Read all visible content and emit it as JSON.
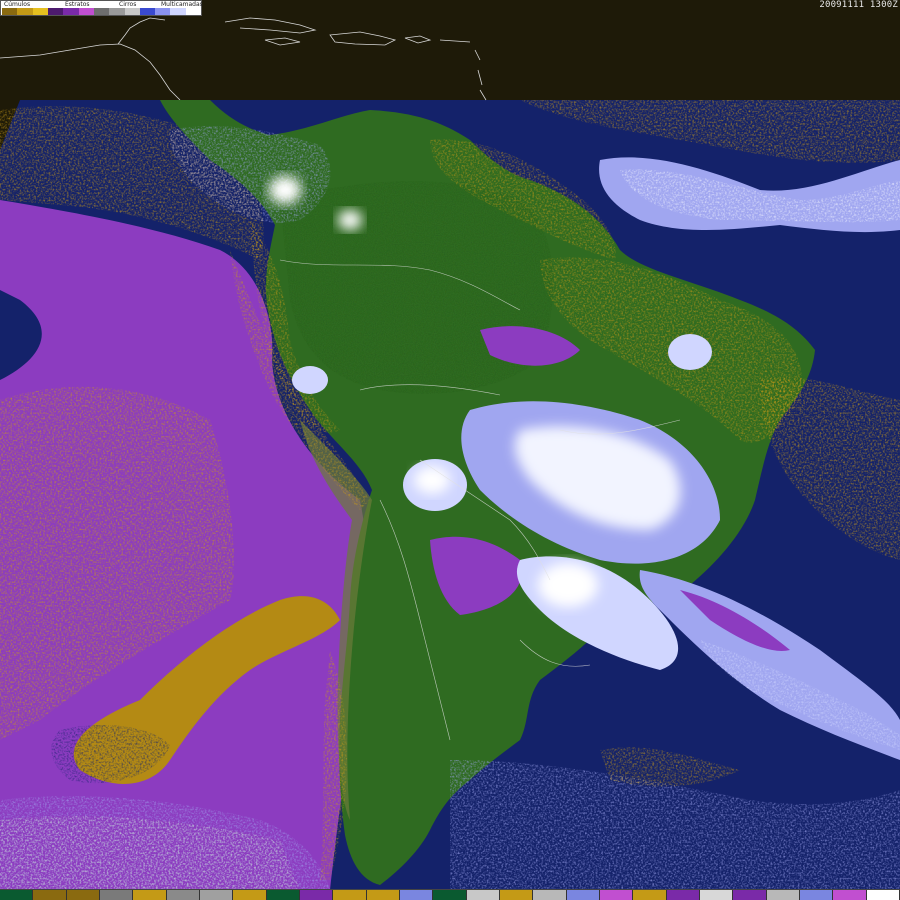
{
  "legend": {
    "categories": [
      "Cúmulos",
      "Estratos",
      "Cirros",
      "Multicamadas"
    ],
    "colors": [
      "#8a6a10",
      "#c49a16",
      "#e6c020",
      "#4d1a6e",
      "#7a2aa8",
      "#c14fd0",
      "#6e6e6e",
      "#9a9a9a",
      "#c8c8c8",
      "#3a4ad0",
      "#8a92f0",
      "#d0d6ff",
      "#ffffff"
    ]
  },
  "timestamp": "20091111 1300Z",
  "bottom_strip": {
    "colors": [
      "#0a5a30",
      "#8a6a10",
      "#8a6a10",
      "#7a7a7a",
      "#c49a16",
      "#8a8a8a",
      "#a0a0a0",
      "#c49a16",
      "#0a5a30",
      "#7a2aa8",
      "#c49a16",
      "#c49a16",
      "#7a86e0",
      "#0a5a30",
      "#c8c8c8",
      "#c49a16",
      "#b8b8b8",
      "#7a86e0",
      "#c14fd0",
      "#c49a16",
      "#7a2aa8",
      "#d8d8d8",
      "#7a2aa8",
      "#b8b8b8",
      "#7a86e0",
      "#c14fd0",
      "#ffffff"
    ]
  },
  "colors": {
    "ocean": "#14226a",
    "land": "#2f6b21",
    "land_dark": "#1f5018",
    "stratus": "#8c3cc0",
    "cumulus": "#c89a18",
    "cirrus": "#a0a6f0",
    "multilayer": "#f2f4ff",
    "header_band": "#1e1a08"
  }
}
